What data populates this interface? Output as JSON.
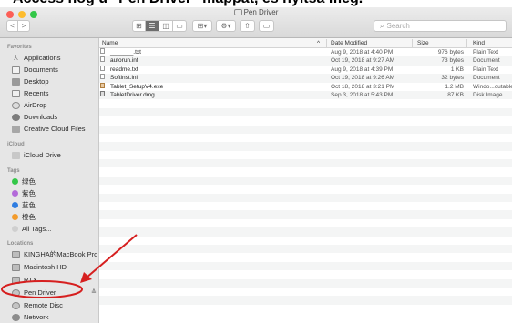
{
  "caption": "Access nog u \"Pen Driver\" mappat, és nyitsa meg.",
  "window": {
    "title": "Pen Driver",
    "nav": {
      "back": "<",
      "forward": ">"
    },
    "search_placeholder": "Search"
  },
  "sidebar": {
    "favorites_header": "Favorites",
    "favorites": [
      {
        "label": "Applications",
        "icon": "applications-icon"
      },
      {
        "label": "Documents",
        "icon": "documents-icon"
      },
      {
        "label": "Desktop",
        "icon": "desktop-icon"
      },
      {
        "label": "Recents",
        "icon": "recents-icon"
      },
      {
        "label": "AirDrop",
        "icon": "airdrop-icon"
      },
      {
        "label": "Downloads",
        "icon": "downloads-icon"
      },
      {
        "label": "Creative Cloud Files",
        "icon": "folder-icon"
      }
    ],
    "icloud_header": "iCloud",
    "icloud": [
      {
        "label": "iCloud Drive",
        "icon": "cloud-icon"
      }
    ],
    "tags_header": "Tags",
    "tags": [
      {
        "label": "绿色",
        "color": "#33c748"
      },
      {
        "label": "紫色",
        "color": "#b36ad9"
      },
      {
        "label": "蓝色",
        "color": "#2f7de1"
      },
      {
        "label": "橙色",
        "color": "#f39b2b"
      },
      {
        "label": "All Tags...",
        "color": "#cfcfcf"
      }
    ],
    "locations_header": "Locations",
    "locations": [
      {
        "label": "KINGHA的MacBook Pro",
        "icon": "laptop-icon"
      },
      {
        "label": "Macintosh HD",
        "icon": "hard-drive-icon"
      },
      {
        "label": "RTX",
        "icon": "external-drive-icon"
      },
      {
        "label": "Pen Driver",
        "icon": "disc-icon",
        "selected": true
      },
      {
        "label": "Remote Disc",
        "icon": "disc-icon"
      },
      {
        "label": "Network",
        "icon": "network-icon"
      }
    ],
    "eject": "≙"
  },
  "columns": {
    "name": "Name",
    "date": "Date Modified",
    "size": "Size",
    "kind": "Kind"
  },
  "files": [
    {
      "name": "_______.txt",
      "date": "Aug 9, 2018 at 4:40 PM",
      "size": "976 bytes",
      "kind": "Plain Text",
      "type": "txt"
    },
    {
      "name": "autorun.inf",
      "date": "Oct 19, 2018 at 9:27 AM",
      "size": "73 bytes",
      "kind": "Document",
      "type": "txt"
    },
    {
      "name": "readme.txt",
      "date": "Aug 9, 2018 at 4:39 PM",
      "size": "1 KB",
      "kind": "Plain Text",
      "type": "txt"
    },
    {
      "name": "Softinst.ini",
      "date": "Oct 19, 2018 at 9:26 AM",
      "size": "32 bytes",
      "kind": "Document",
      "type": "txt"
    },
    {
      "name": "Tablet_SetupV4.exe",
      "date": "Oct 18, 2018 at 3:21 PM",
      "size": "1.2 MB",
      "kind": "Windo...cutable",
      "type": "exe"
    },
    {
      "name": "TabletDriver.dmg",
      "date": "Sep 3, 2018 at 5:43 PM",
      "size": "87 KB",
      "kind": "Disk Image",
      "type": "dmg"
    }
  ],
  "colors": {
    "annotation": "#d61f1f",
    "selection": "#d0d0d0"
  }
}
